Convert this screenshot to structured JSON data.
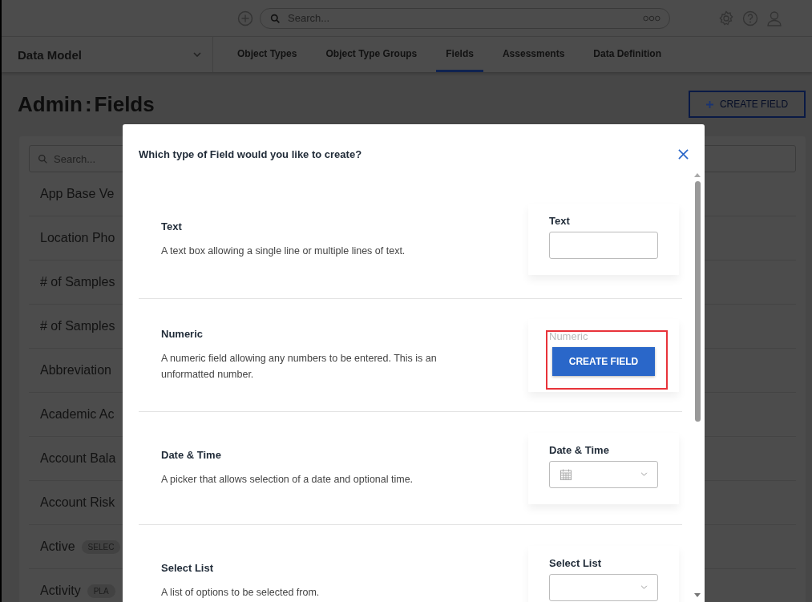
{
  "top_bar": {
    "search": {
      "placeholder": "Search..."
    }
  },
  "nav": {
    "module": "Data Model",
    "tabs": [
      {
        "label": "Object Types",
        "selected": false
      },
      {
        "label": "Object Type Groups",
        "selected": false
      },
      {
        "label": "Fields",
        "selected": true
      },
      {
        "label": "Assessments",
        "selected": false
      },
      {
        "label": "Data Definition",
        "selected": false
      }
    ]
  },
  "page": {
    "title_prefix": "Admin",
    "title_separator": ":",
    "title": "Fields",
    "create_button": "CREATE FIELD",
    "search": {
      "placeholder": "Search..."
    },
    "rows": [
      {
        "name": "App Base Ve"
      },
      {
        "name": "Location Pho"
      },
      {
        "name": "# of Samples"
      },
      {
        "name": "# of Samples"
      },
      {
        "name": "Abbreviation"
      },
      {
        "name": "Academic Ac"
      },
      {
        "name": "Account Bala"
      },
      {
        "name": "Account Risk"
      },
      {
        "name": "Active",
        "badge": "SELEC"
      },
      {
        "name": "Activity",
        "badge": "PLA"
      }
    ]
  },
  "modal": {
    "title": "Which type of Field would you like to create?",
    "types": [
      {
        "kind": "text",
        "name": "Text",
        "description": "A text box allowing a single line or multiple lines of text.",
        "preview_label": "Text",
        "dimmed": false,
        "highlighted": false
      },
      {
        "kind": "numeric",
        "name": "Numeric",
        "description": "A numeric field allowing any numbers to be entered. This is an unformatted number.",
        "preview_label": "Numeric",
        "dimmed": true,
        "highlighted": true,
        "button": "CREATE FIELD"
      },
      {
        "kind": "datetime",
        "name": "Date & Time",
        "description": "A picker that allows selection of a date and optional time.",
        "preview_label": "Date & Time",
        "dimmed": false,
        "highlighted": false
      },
      {
        "kind": "select",
        "name": "Select List",
        "description": "A list of options to be selected from.",
        "preview_label": "Select List",
        "dimmed": false,
        "highlighted": false
      }
    ]
  }
}
